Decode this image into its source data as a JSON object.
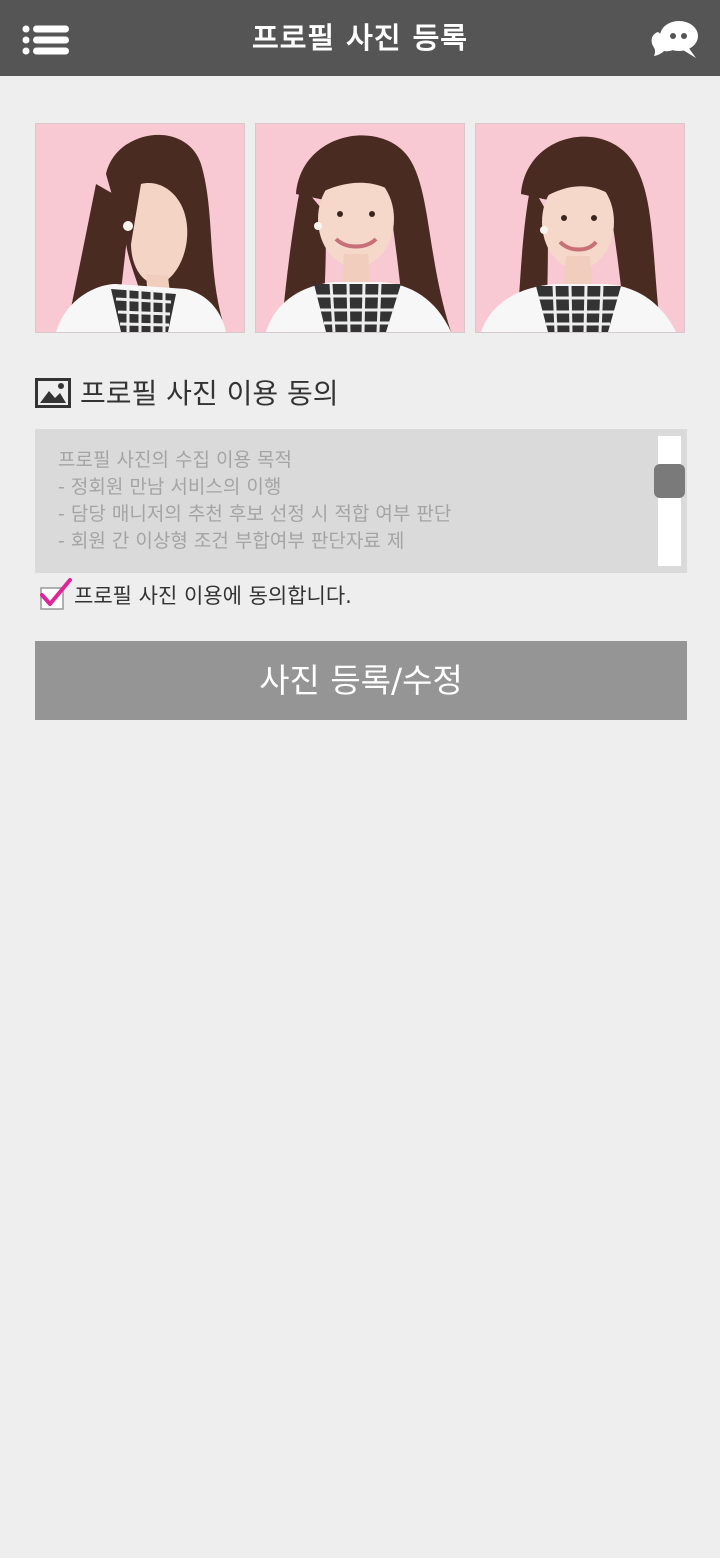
{
  "header": {
    "title": "프로필 사진 등록",
    "menu_icon": "list-menu-icon",
    "chat_icon": "chat-bubbles-icon",
    "background": "#555555"
  },
  "photos": [
    {
      "pose": "side-profile",
      "background": "#f9c9d3"
    },
    {
      "pose": "front-smile",
      "background": "#f9c9d3"
    },
    {
      "pose": "three-quarter-smile",
      "background": "#f9c9d3"
    }
  ],
  "consent": {
    "icon": "image-icon",
    "title": "프로필 사진 이용 동의",
    "terms_lines": [
      "프로필 사진의 수집 이용 목적",
      "- 정회원 만남 서비스의 이행",
      "- 담당 매니저의 추천 후보 선정 시 적합 여부 판단",
      "- 회원 간 이상형 조건 부합여부 판단자료 제"
    ],
    "checkbox_checked": true,
    "checkbox_label": "프로필 사진 이용에 동의합니다.",
    "accent": "#e0249a"
  },
  "submit": {
    "label": "사진 등록/수정",
    "background": "#959595"
  }
}
